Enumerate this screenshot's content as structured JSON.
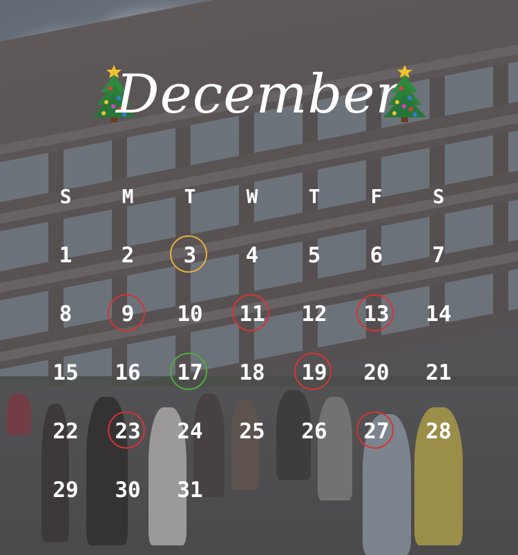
{
  "title": "December",
  "decoration": {
    "left": "christmas-tree-icon",
    "right": "christmas-tree-icon"
  },
  "weekdays": [
    "S",
    "M",
    "T",
    "W",
    "T",
    "F",
    "S"
  ],
  "weeks": [
    [
      "",
      "",
      "",
      "",
      "",
      "",
      ""
    ],
    [
      "1",
      "2",
      "3",
      "4",
      "5",
      "6",
      "7"
    ],
    [
      "8",
      "9",
      "10",
      "11",
      "12",
      "13",
      "14"
    ],
    [
      "15",
      "16",
      "17",
      "18",
      "19",
      "20",
      "21"
    ],
    [
      "22",
      "23",
      "24",
      "25",
      "26",
      "27",
      "28"
    ],
    [
      "29",
      "30",
      "31",
      "",
      "",
      "",
      ""
    ]
  ],
  "marked_days": [
    {
      "day": "3",
      "color": "#e8b33b"
    },
    {
      "day": "9",
      "color": "#d63434"
    },
    {
      "day": "11",
      "color": "#d63434"
    },
    {
      "day": "13",
      "color": "#d63434"
    },
    {
      "day": "17",
      "color": "#4fae3f"
    },
    {
      "day": "19",
      "color": "#d63434"
    },
    {
      "day": "23",
      "color": "#d63434"
    },
    {
      "day": "27",
      "color": "#d63434"
    }
  ]
}
